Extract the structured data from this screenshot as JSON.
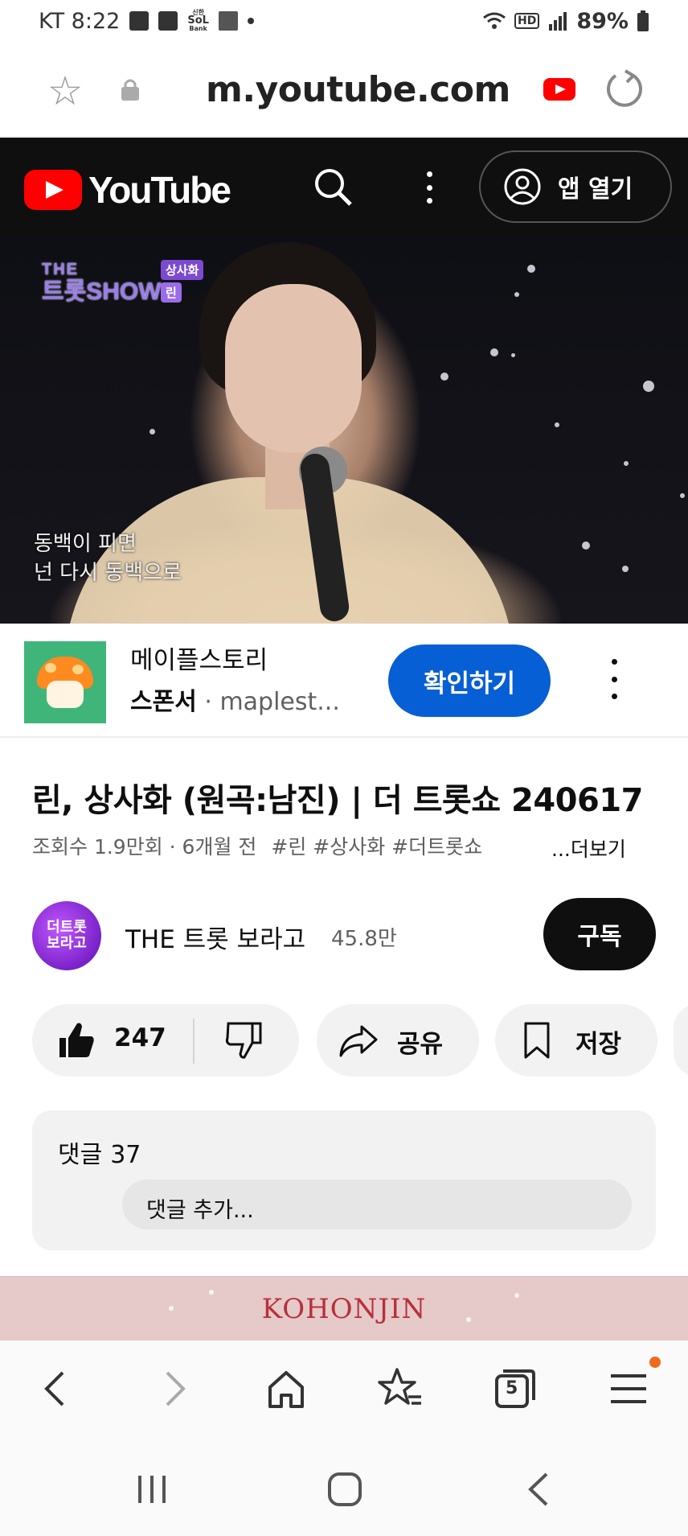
{
  "status_bar": {
    "carrier_time": "KT 8:22",
    "bank_label_top": "신한",
    "bank_label_mid": "SoL",
    "bank_label_bot": "Bank",
    "network": "HD",
    "battery": "89%"
  },
  "browser": {
    "url": "m.youtube.com"
  },
  "yt_header": {
    "logo_text": "YouTube",
    "open_app_label": "앱 열기"
  },
  "video": {
    "show_top": "THE",
    "show_name": "트롯SHOW",
    "song_tag": "상사화",
    "artist_tag": "린",
    "lyric_1": "동백이 피면",
    "lyric_2": "넌 다시 동백으로"
  },
  "ad": {
    "title": "메이플스토리",
    "sponsor_label": "스폰서",
    "sponsor_domain": "maplest...",
    "cta_label": "확인하기"
  },
  "video_info": {
    "title": "린, 상사화 (원곡:남진) | 더 트롯쇼 240617",
    "views": "조회수 1.9만회 · 6개월 전",
    "tags": "#린 #상사화 #더트롯쇼",
    "more_label": "...더보기"
  },
  "channel": {
    "avatar_text_1": "더트롯",
    "avatar_text_2": "보라고",
    "name": "THE 트롯 보라고",
    "subscribers": "45.8만",
    "subscribe_label": "구독"
  },
  "actions": {
    "like_count": "247",
    "share_label": "공유",
    "save_label": "저장"
  },
  "comments": {
    "label": "댓글",
    "count": "37",
    "placeholder": "댓글 추가..."
  },
  "banner": {
    "brand": "KOHONJIN"
  },
  "browser_nav": {
    "tab_count": "5"
  },
  "colors": {
    "youtube_red": "#ff0000",
    "cta_blue": "#065fd4",
    "banner_bg": "#e6c9c9",
    "banner_text": "#b8303a"
  }
}
